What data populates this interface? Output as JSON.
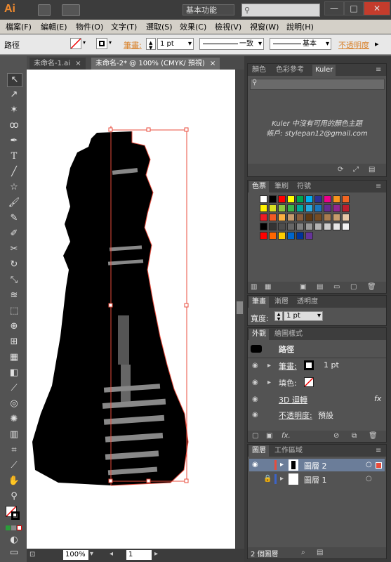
{
  "app": {
    "logo": "Ai",
    "workspace": "基本功能",
    "search_placeholder": "",
    "win_minimize": "—",
    "win_maximize": "□",
    "win_close": "✕"
  },
  "menubar": {
    "items": [
      "檔案(F)",
      "編輯(E)",
      "物件(O)",
      "文字(T)",
      "選取(S)",
      "效果(C)",
      "檢視(V)",
      "視窗(W)",
      "說明(H)"
    ]
  },
  "control_bar": {
    "object_type": "路徑",
    "stroke_label": "筆畫:",
    "stroke_weight": "1 pt",
    "profile_label": "一致",
    "brush_label": "基本",
    "opacity_label": "不透明度"
  },
  "doc_tabs": [
    {
      "label": "未命名-1.ai",
      "active": false
    },
    {
      "label": "未命名-2* @ 100% (CMYK/ 預視)",
      "active": true
    }
  ],
  "status_bar": {
    "zoom": "100%",
    "page": "1"
  },
  "color_panel": {
    "tabs": [
      "顏色",
      "色彩參考",
      "Kuler"
    ],
    "active_tab": "Kuler",
    "message_line1": "Kuler 中沒有可用的顏色主題",
    "message_line2": "帳戶: stylepan12@gmail.com"
  },
  "swatches_panel": {
    "tabs": [
      "色票",
      "筆刷",
      "符號"
    ],
    "active_tab": "色票",
    "colors": [
      "#ffffff",
      "#000000",
      "#ff0000",
      "#ffff00",
      "#00a651",
      "#00aeef",
      "#2e3192",
      "#ec008c",
      "#f7941d",
      "#f26522",
      "#fff200",
      "#d7df23",
      "#8dc63f",
      "#39b54a",
      "#00a99d",
      "#27aae1",
      "#1c75bc",
      "#662d91",
      "#92278f",
      "#be1e2d",
      "#ed1c24",
      "#f15a24",
      "#fbb040",
      "#c49a6c",
      "#8b5e3c",
      "#603913",
      "#754c24",
      "#a97c50",
      "#c69c6d",
      "#e6c9a8",
      "#000000",
      "#333333",
      "#4d4d4d",
      "#666666",
      "#808080",
      "#999999",
      "#b3b3b3",
      "#cccccc",
      "#e6e6e6",
      "#f2f2f2",
      "#ff0000",
      "#ff6600",
      "#ffcc00",
      "#0066cc",
      "#003399",
      "#663399"
    ]
  },
  "stroke_panel": {
    "tabs": [
      "筆畫",
      "漸層",
      "透明度"
    ],
    "active_tab": "筆畫",
    "weight_label": "寬度:",
    "weight_value": "1 pt"
  },
  "appearance_panel": {
    "tabs": [
      "外觀",
      "繪圖樣式"
    ],
    "active_tab": "外觀",
    "object_name": "路徑",
    "stroke_label": "筆畫:",
    "stroke_value": "1 pt",
    "fill_label": "填色:",
    "effect_label": "3D 迴轉",
    "opacity_label": "不透明度:",
    "opacity_value": "預設",
    "fx": "fx"
  },
  "layers_panel": {
    "tabs": [
      "圖層",
      "工作區域"
    ],
    "active_tab": "圖層",
    "layers": [
      {
        "name": "圖層 2",
        "color": "#e84c3d",
        "visible": true,
        "locked": false,
        "selected": true
      },
      {
        "name": "圖層 1",
        "color": "#3c63c7",
        "visible": false,
        "locked": true,
        "selected": false
      }
    ],
    "footer": "2 個圖層"
  },
  "colors": {
    "accent_orange": "#d9822b",
    "selection_red": "#e84c3d",
    "panel_bg": "#535353"
  }
}
